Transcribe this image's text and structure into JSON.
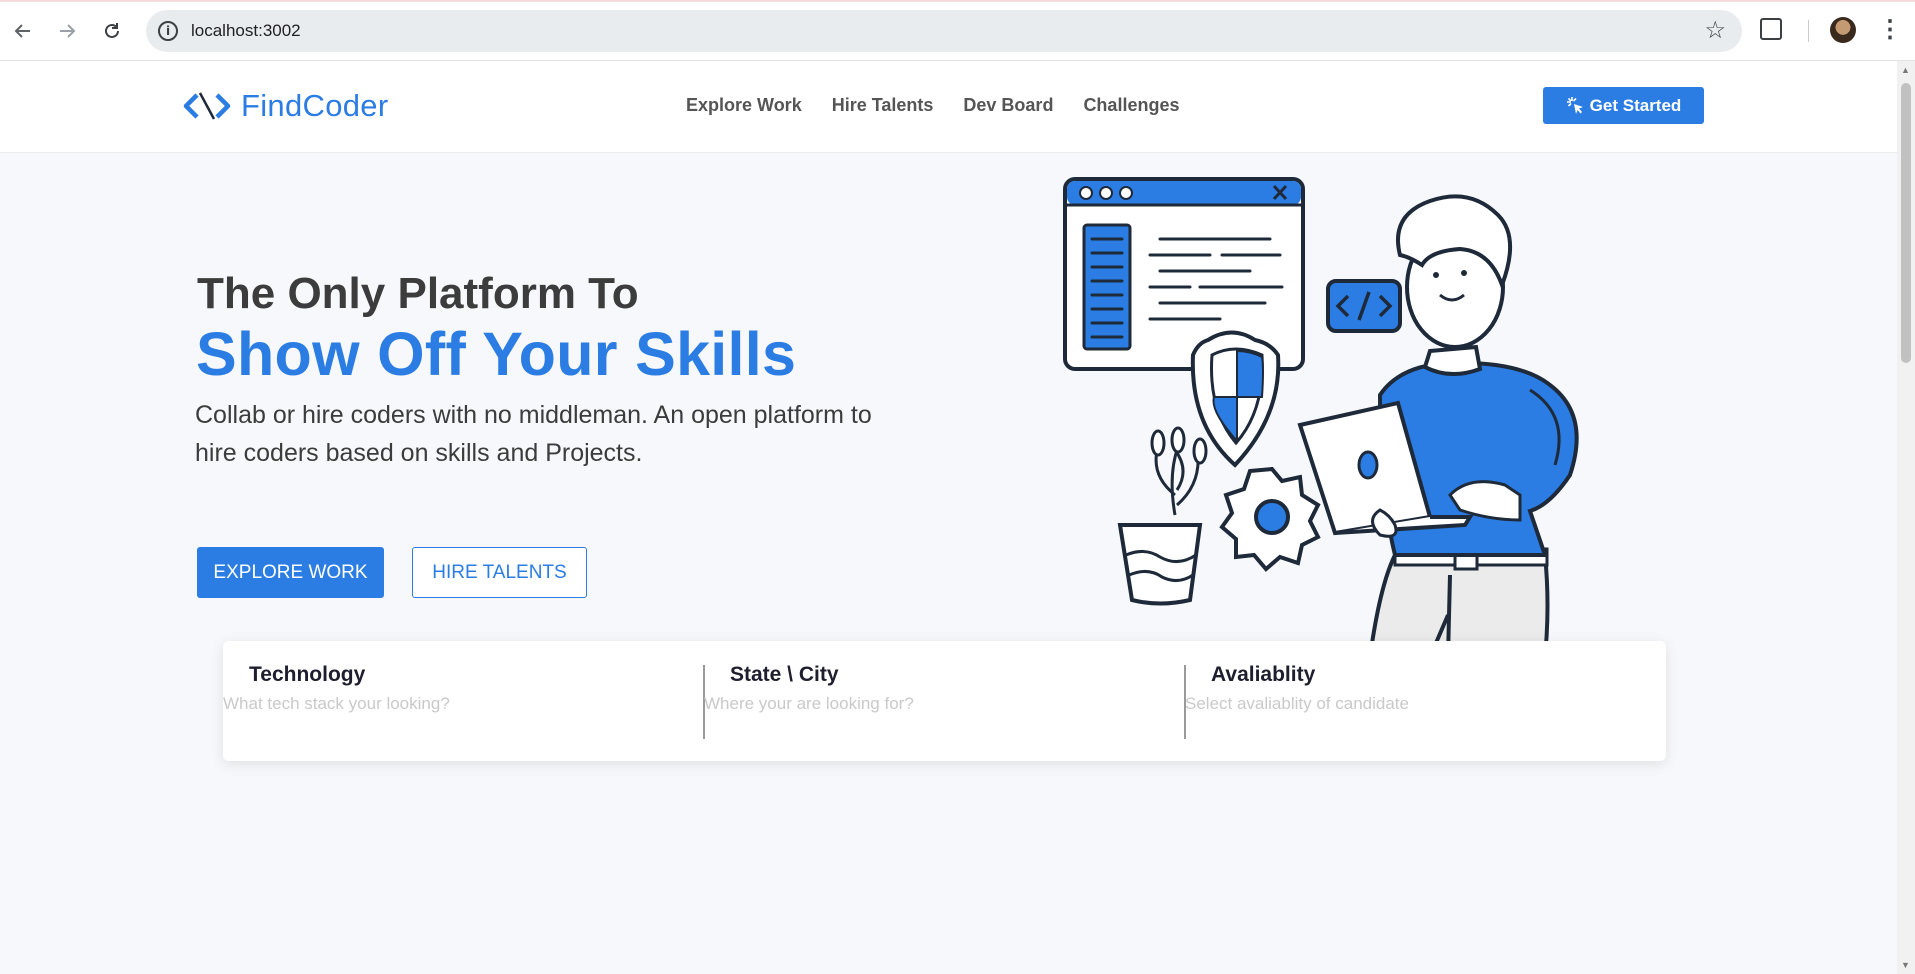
{
  "browser": {
    "url": "localhost:3002"
  },
  "nav": {
    "brand": "FindCoder",
    "links": [
      "Explore Work",
      "Hire Talents",
      "Dev Board",
      "Challenges"
    ],
    "cta_label": "Get Started"
  },
  "hero": {
    "line1": "The Only Platform To",
    "line2": "Show Off Your Skills",
    "lead_line1": "Collab or hire coders with no middleman. An open platform to",
    "lead_line2": "hire coders based on skills and Projects.",
    "primary_button": "EXPLORE WORK",
    "secondary_button": "HIRE TALENTS"
  },
  "search": {
    "fields": [
      {
        "label": "Technology",
        "placeholder": "What tech stack your looking?"
      },
      {
        "label": "State \\ City",
        "placeholder": "Where your are looking for?"
      },
      {
        "label": "Avaliablity",
        "placeholder": "Select avaliablity of candidate"
      }
    ]
  },
  "colors": {
    "brand_blue": "#2b7de3",
    "heading_dark": "#3c3c3c",
    "hero_background": "#f6f8fb"
  },
  "icons": [
    "back-arrow-icon",
    "forward-arrow-icon",
    "reload-icon",
    "site-info-icon",
    "bookmark-star-icon",
    "extensions-icon",
    "profile-avatar",
    "more-menu-icon",
    "findcoder-logo-icon",
    "cursor-click-icon"
  ]
}
